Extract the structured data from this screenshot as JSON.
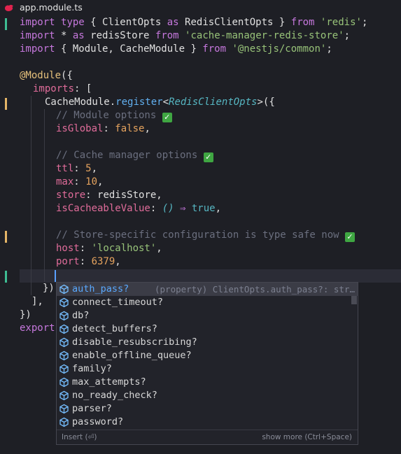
{
  "tab": {
    "filename": "app.module.ts"
  },
  "code": {
    "l1": [
      "import",
      " ",
      "type",
      " { ClientOpts ",
      "as",
      " RedisClientOpts } ",
      "from",
      " ",
      "'redis'",
      ";"
    ],
    "l2": [
      "import",
      " * ",
      "as",
      " redisStore ",
      "from",
      " ",
      "'cache-manager-redis-store'",
      ";"
    ],
    "l3": [
      "import",
      " { Module, CacheModule } ",
      "from",
      " ",
      "'@nestjs/common'",
      ";"
    ],
    "l5": [
      "@Module",
      "({"
    ],
    "l6": [
      "imports",
      ": ["
    ],
    "l7": [
      "CacheModule",
      ".",
      "register",
      "<",
      "RedisClientOpts",
      ">({"
    ],
    "l8": [
      "// Module options "
    ],
    "l9": [
      "isGlobal",
      ": ",
      "false",
      ","
    ],
    "l11": [
      "// Cache manager options "
    ],
    "l12": [
      "ttl",
      ": ",
      "5",
      ","
    ],
    "l13": [
      "max",
      ": ",
      "10",
      ","
    ],
    "l14": [
      "store",
      ": redisStore,"
    ],
    "l15": [
      "isCacheableValue",
      ": ",
      "()",
      " ⇒ ",
      "true",
      ","
    ],
    "l17": [
      "// Store-specific configuration is type safe now "
    ],
    "l18": [
      "host",
      ": ",
      "'localhost'",
      ","
    ],
    "l19": [
      "port",
      ": ",
      "6379",
      ","
    ],
    "l21": [
      "})"
    ],
    "l22": [
      "],"
    ],
    "l23": [
      "})"
    ],
    "l24": [
      "export"
    ]
  },
  "suggest": {
    "items": [
      {
        "label": "auth_pass?",
        "detail": "(property) ClientOpts.auth_pass?: str…",
        "selected": true
      },
      {
        "label": "connect_timeout?"
      },
      {
        "label": "db?"
      },
      {
        "label": "detect_buffers?"
      },
      {
        "label": "disable_resubscribing?"
      },
      {
        "label": "enable_offline_queue?"
      },
      {
        "label": "family?"
      },
      {
        "label": "max_attempts?"
      },
      {
        "label": "no_ready_check?"
      },
      {
        "label": "parser?"
      },
      {
        "label": "password?"
      }
    ],
    "footer_left": "Insert (⏎)",
    "footer_right": "show more (Ctrl+Space)"
  },
  "icons": {
    "property": "cube-icon",
    "check": "check-mark-icon",
    "file": "nestjs-icon"
  },
  "colors": {
    "background": "#1e1f25",
    "keyword": "#c678dd",
    "string": "#98c379",
    "number": "#e5a35e",
    "property": "#e06c9a",
    "match": "#5aa9ff",
    "gutter_added": "#3ebd93",
    "gutter_modified": "#e5b567"
  }
}
